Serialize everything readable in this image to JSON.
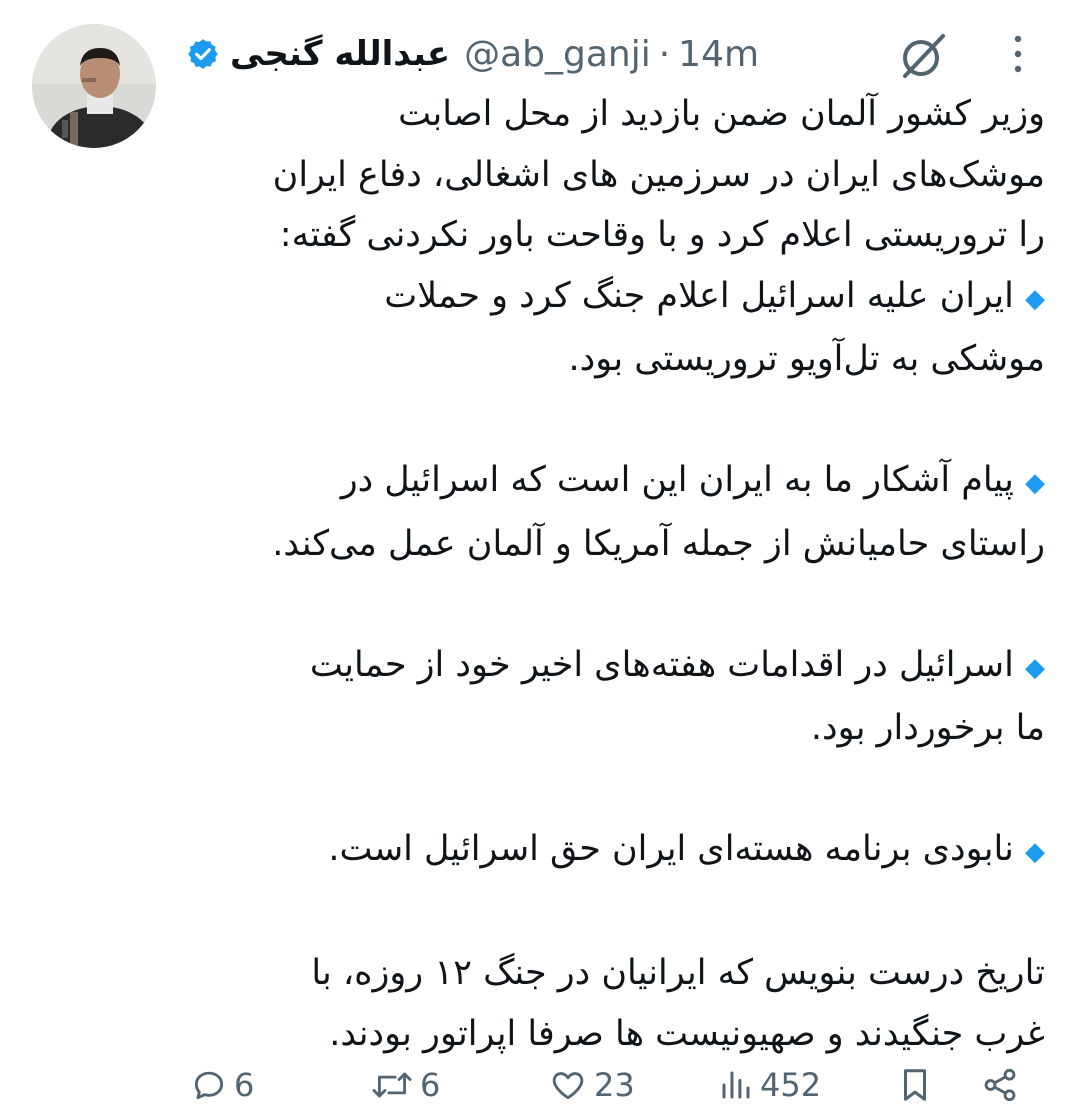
{
  "tweet": {
    "display_name": "عبدالله گنجی",
    "handle": "@ab_ganji",
    "separator": "·",
    "time": "14m",
    "body": {
      "intro_1": "وزیر کشور آلمان ضمن بازدید از محل اصابت",
      "intro_2": "موشک‌های ایران در سرزمین های اشغالی، دفاع ایران",
      "intro_3": "را تروریستی اعلام کرد و با وقاحت باور نکردنی گفته:",
      "bullet_1_line_1": "ایران علیه اسرائیل اعلام جنگ کرد و حملات",
      "bullet_1_line_2": "موشکی به تل‌آویو تروریستی بود.",
      "bullet_2_line_1": "پیام آشکار ما به ایران این است که اسرائیل در",
      "bullet_2_line_2": "راستای حامیانش از جمله آمریکا و آلمان عمل می‌کند.",
      "bullet_3_line_1": "اسرائیل در اقدامات هفته‌های اخیر خود از حمایت",
      "bullet_3_line_2": "ما برخوردار بود.",
      "bullet_4_line_1": "نابودی برنامه هسته‌ای ایران حق اسرائیل است.",
      "closing_1": "تاریخ درست بنویس که ایرانیان در جنگ ۱۲ روزه، با",
      "closing_2": "غرب جنگیدند و صهیونیست ها  صرفا اپراتور بودند."
    },
    "stats": {
      "replies": "6",
      "reposts": "6",
      "likes": "23",
      "views": "452"
    }
  },
  "icons": {
    "verified": "verified-badge-icon",
    "grok": "grok-icon",
    "more": "more-vertical-icon",
    "reply": "reply-icon",
    "repost": "repost-icon",
    "like": "heart-icon",
    "views": "views-icon",
    "bookmark": "bookmark-icon",
    "share": "share-icon"
  },
  "colors": {
    "text": "#0f1419",
    "secondary": "#536471",
    "accent": "#1d9bf0"
  }
}
